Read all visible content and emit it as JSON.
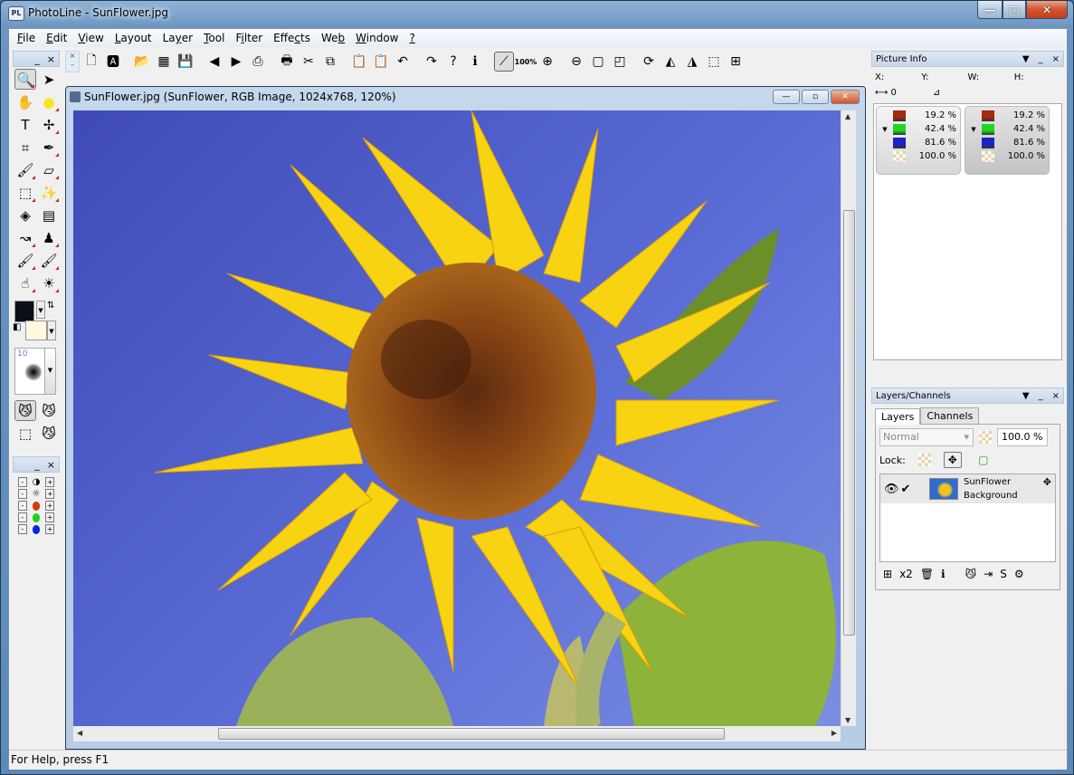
{
  "window": {
    "title": "PhotoLine - SunFlower.jpg",
    "app_icon": "PL",
    "minimize": "—",
    "maximize": "□",
    "close": "✕"
  },
  "menu": [
    {
      "label": "File",
      "accel": "F",
      "rest": "ile"
    },
    {
      "label": "Edit",
      "accel": "E",
      "rest": "dit"
    },
    {
      "label": "View",
      "accel": "V",
      "rest": "iew"
    },
    {
      "label": "Layout",
      "accel": "L",
      "rest": "ayout"
    },
    {
      "label": "Layer",
      "pre": "La",
      "accel": "y",
      "rest": "er"
    },
    {
      "label": "Tool",
      "accel": "T",
      "rest": "ool"
    },
    {
      "label": "Filter",
      "pre": "F",
      "accel": "i",
      "rest": "lter"
    },
    {
      "label": "Effects",
      "pre": "Effe",
      "accel": "c",
      "rest": "ts"
    },
    {
      "label": "Web",
      "pre": "We",
      "accel": "b",
      "rest": ""
    },
    {
      "label": "Window",
      "accel": "W",
      "rest": "indow"
    },
    {
      "label": "?",
      "accel": "?",
      "rest": ""
    }
  ],
  "toolbar": {
    "items": [
      {
        "name": "new-document-icon",
        "glyph": "🗋"
      },
      {
        "name": "new-text-document-icon",
        "glyph": "🅰"
      },
      {
        "name": "open-folder-icon",
        "glyph": "📂"
      },
      {
        "name": "browser-icon",
        "glyph": "▦"
      },
      {
        "name": "save-icon",
        "glyph": "💾"
      },
      {
        "name": "previous-icon",
        "glyph": "◀"
      },
      {
        "name": "next-icon",
        "glyph": "▶"
      },
      {
        "name": "scan-icon",
        "glyph": "⎙"
      },
      {
        "name": "print-icon",
        "glyph": "🖶"
      },
      {
        "name": "cut-icon",
        "glyph": "✂"
      },
      {
        "name": "copy-icon",
        "glyph": "⧉"
      },
      {
        "name": "paste-icon",
        "glyph": "📋"
      },
      {
        "name": "paste-new-icon",
        "glyph": "📋"
      },
      {
        "name": "undo-icon",
        "glyph": "↶"
      },
      {
        "name": "redo-icon",
        "glyph": "↷"
      },
      {
        "name": "help-pointer-icon",
        "glyph": "?"
      },
      {
        "name": "info-icon",
        "glyph": "ℹ"
      },
      {
        "name": "line-tool-icon",
        "glyph": "⟋",
        "active": true
      },
      {
        "name": "zoom-100-icon",
        "text": "100%"
      },
      {
        "name": "zoom-in-icon",
        "glyph": "⊕"
      },
      {
        "name": "zoom-out-icon",
        "glyph": "⊖"
      },
      {
        "name": "page-icon",
        "glyph": "▢"
      },
      {
        "name": "page-fold-icon",
        "glyph": "◰"
      },
      {
        "name": "rotate-selection-icon",
        "glyph": "⟳"
      },
      {
        "name": "flip-horizontal-icon",
        "glyph": "◭"
      },
      {
        "name": "flip-vertical-icon",
        "glyph": "◮"
      },
      {
        "name": "crop-selection-icon",
        "glyph": "⬚"
      },
      {
        "name": "grid-icon",
        "glyph": "⊞"
      }
    ]
  },
  "toolbox": {
    "close": "×",
    "minimize": "_",
    "tools": [
      {
        "name": "zoom-tool-icon",
        "glyph": "🔍",
        "active": true,
        "tri": true
      },
      {
        "name": "pointer-tool-icon",
        "glyph": "➤"
      },
      {
        "name": "hand-tool-icon",
        "glyph": "✋"
      },
      {
        "name": "ellipse-tool-icon",
        "glyph": "●",
        "color": "#f6e51a",
        "tri": true
      },
      {
        "name": "text-tool-icon",
        "glyph": "T"
      },
      {
        "name": "path-tool-icon",
        "glyph": "✢",
        "tri": true
      },
      {
        "name": "crop-tool-icon",
        "glyph": "⌗"
      },
      {
        "name": "eyedropper-tool-icon",
        "glyph": "✒",
        "tri": true
      },
      {
        "name": "brush-tool-icon",
        "glyph": "🖌",
        "tri": true
      },
      {
        "name": "eraser-tool-icon",
        "glyph": "▱",
        "tri": true
      },
      {
        "name": "rect-select-tool-icon",
        "glyph": "⬚",
        "tri": true
      },
      {
        "name": "magic-wand-tool-icon",
        "glyph": "✨",
        "tri": true
      },
      {
        "name": "fill-tool-icon",
        "glyph": "◈"
      },
      {
        "name": "gradient-tool-icon",
        "glyph": "▤"
      },
      {
        "name": "smudge-tool-icon",
        "glyph": "↝",
        "tri": true
      },
      {
        "name": "stamp-tool-icon",
        "glyph": "♟",
        "tri": true
      },
      {
        "name": "dodge-brush-tool-icon",
        "glyph": "🖌",
        "tri": true
      },
      {
        "name": "texture-brush-tool-icon",
        "glyph": "🖌",
        "tri": true
      },
      {
        "name": "finger-tool-icon",
        "glyph": "☝",
        "tri": true
      },
      {
        "name": "light-brush-tool-icon",
        "glyph": "☀",
        "tri": true
      }
    ],
    "brush_size": "10",
    "mask_tools": [
      {
        "name": "mask-mode-icon",
        "glyph": "😼",
        "active": true
      },
      {
        "name": "mask-brush-icon",
        "glyph": "😼"
      },
      {
        "name": "mask-selection-icon",
        "glyph": "⬚"
      },
      {
        "name": "mask-view-icon",
        "glyph": "😼"
      }
    ]
  },
  "adjust_panel": {
    "close": "×",
    "minimize": "_",
    "rows": [
      {
        "name": "contrast",
        "icon": "contrast-icon",
        "color": "#000000",
        "glyph": "◑"
      },
      {
        "name": "brightness",
        "icon": "brightness-icon",
        "color": "#000000",
        "glyph": "☼"
      },
      {
        "name": "red",
        "icon": "red-channel-icon",
        "color": "#d23a10"
      },
      {
        "name": "green",
        "icon": "green-channel-icon",
        "color": "#17d817"
      },
      {
        "name": "blue",
        "icon": "blue-channel-icon",
        "color": "#0a22e6"
      }
    ],
    "minus": "-",
    "plus": "+"
  },
  "document": {
    "title": "SunFlower.jpg  (SunFlower, RGB Image, 1024x768, 120%)",
    "minimize": "—",
    "maximize": "▫",
    "close": "✕"
  },
  "picture_info": {
    "title": "Picture Info",
    "labels": {
      "x": "X:",
      "y": "Y:",
      "w": "W:",
      "h": "H:"
    },
    "distance": "0",
    "panels": [
      {
        "values": [
          {
            "color": "#a3290f",
            "value": "19.2 %"
          },
          {
            "color": "#20d820",
            "value": "42.4 %"
          },
          {
            "color": "#1a22c8",
            "value": "81.6 %"
          },
          {
            "color": "checker",
            "value": "100.0 %"
          }
        ]
      },
      {
        "values": [
          {
            "color": "#a3290f",
            "value": "19.2 %"
          },
          {
            "color": "#20d820",
            "value": "42.4 %"
          },
          {
            "color": "#1a22c8",
            "value": "81.6 %"
          },
          {
            "color": "checker",
            "value": "100.0 %"
          }
        ]
      }
    ]
  },
  "layers_panel": {
    "title": "Layers/Channels",
    "tabs": [
      {
        "label": "Layers",
        "selected": true
      },
      {
        "label": "Channels",
        "selected": false
      }
    ],
    "blend_mode": "Normal",
    "opacity": "100.0 %",
    "lock_label": "Lock:",
    "layers": [
      {
        "name": "SunFlower",
        "subtitle": "Background",
        "visible": true,
        "checked": true
      }
    ],
    "buttons": [
      {
        "name": "new-layer-icon",
        "glyph": "⊞"
      },
      {
        "name": "duplicate-layer-icon",
        "glyph": "x2"
      },
      {
        "name": "delete-layer-icon",
        "glyph": "🗑"
      },
      {
        "name": "layer-info-icon",
        "glyph": "ℹ"
      },
      {
        "name": "layer-mask-icon",
        "glyph": "😼"
      },
      {
        "name": "layer-move-icon",
        "glyph": "⇥"
      },
      {
        "name": "layer-style-icon",
        "glyph": "S"
      },
      {
        "name": "layer-settings-icon",
        "glyph": "⚙"
      }
    ]
  },
  "status": {
    "text": "For Help, press F1"
  }
}
